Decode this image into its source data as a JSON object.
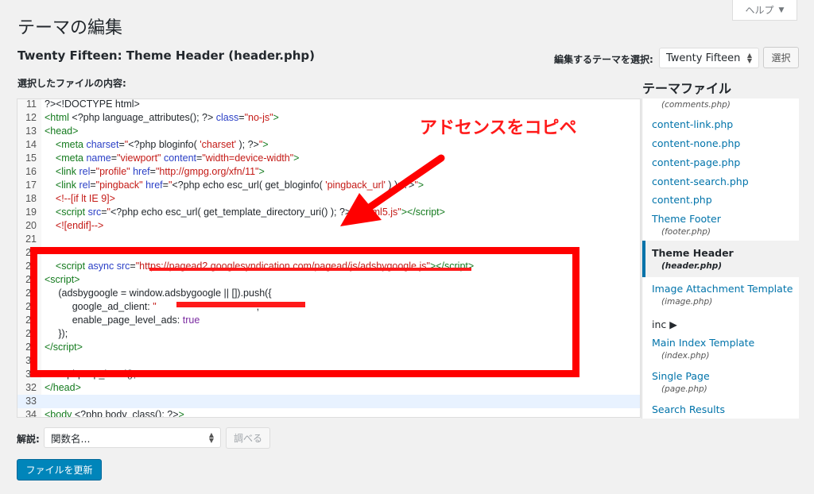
{
  "help": {
    "label": "ヘルプ",
    "arrow": "▼"
  },
  "page_title": "テーマの編集",
  "file_title": "Twenty Fifteen: Theme Header (header.php)",
  "theme_select": {
    "label": "編集するテーマを選択:",
    "value": "Twenty Fifteen",
    "button": "選択"
  },
  "content_label": "選択したファイルの内容:",
  "annotation": {
    "text": "アドセンスをコピペ",
    "color": "#ff0000"
  },
  "code_lines": [
    {
      "n": "11",
      "html": "?&gt;&lt;!DOCTYPE html&gt;"
    },
    {
      "n": "12",
      "html": "<span class=\"t\">&lt;html</span> &lt;?php language_attributes(); ?&gt; <span class=\"a\">class</span>=<span class=\"s\">\"no-js\"</span><span class=\"t\">&gt;</span>"
    },
    {
      "n": "13",
      "html": "<span class=\"t\">&lt;head&gt;</span>"
    },
    {
      "n": "14",
      "html": "    <span class=\"t\">&lt;meta</span> <span class=\"a\">charset</span>=<span class=\"s\">\"</span>&lt;?php bloginfo( <span class=\"s\">'charset'</span> ); ?&gt;<span class=\"s\">\"</span><span class=\"t\">&gt;</span>"
    },
    {
      "n": "15",
      "html": "    <span class=\"t\">&lt;meta</span> <span class=\"a\">name</span>=<span class=\"s\">\"viewport\"</span> <span class=\"a\">content</span>=<span class=\"s\">\"width=device-width\"</span><span class=\"t\">&gt;</span>"
    },
    {
      "n": "16",
      "html": "    <span class=\"t\">&lt;link</span> <span class=\"a\">rel</span>=<span class=\"s\">\"profile\"</span> <span class=\"a\">href</span>=<span class=\"s\">\"http://gmpg.org/xfn/11\"</span><span class=\"t\">&gt;</span>"
    },
    {
      "n": "17",
      "html": "    <span class=\"t\">&lt;link</span> <span class=\"a\">rel</span>=<span class=\"s\">\"pingback\"</span> <span class=\"a\">href</span>=<span class=\"s\">\"</span>&lt;?php echo esc_url( get_bloginfo( <span class=\"s\">'pingback_url'</span> ) ); ?&gt;<span class=\"s\">\"</span><span class=\"t\">&gt;</span>"
    },
    {
      "n": "18",
      "html": "    <span class=\"c\">&lt;!--[if lt IE 9]&gt;</span>"
    },
    {
      "n": "19",
      "html": "    <span class=\"t\">&lt;script</span> <span class=\"a\">src</span>=<span class=\"s\">\"</span>&lt;?php echo esc_url( get_template_directory_uri() ); ?&gt;<span class=\"s\">/js/html5.js\"</span><span class=\"t\">&gt;&lt;/script&gt;</span>"
    },
    {
      "n": "20",
      "html": "    <span class=\"c\">&lt;![endif]--&gt;</span>"
    },
    {
      "n": "21",
      "html": ""
    },
    {
      "n": "22",
      "html": ""
    },
    {
      "n": "23",
      "html": "    <span class=\"t\">&lt;script</span> <span class=\"a\">async</span> <span class=\"a\">src</span>=<span class=\"s\">\"https://pagead2.googlesyndication.com/pagead/js/adsbygoogle.js\"</span><span class=\"t\">&gt;&lt;/script&gt;</span>"
    },
    {
      "n": "24",
      "html": "<span class=\"t\">&lt;script&gt;</span>"
    },
    {
      "n": "25",
      "html": "     (adsbygoogle = window.adsbygoogle || []).push({"
    },
    {
      "n": "26",
      "html": "          google_ad_client: <span class=\"s\">\"                                   \"</span>,"
    },
    {
      "n": "27",
      "html": "          enable_page_level_ads: <span class=\"kw\">true</span>"
    },
    {
      "n": "28",
      "html": "     });"
    },
    {
      "n": "29",
      "html": "<span class=\"t\">&lt;/script&gt;</span>"
    },
    {
      "n": "30",
      "html": ""
    },
    {
      "n": "31",
      "html": "    &lt;?php wp_head(); ?&gt;"
    },
    {
      "n": "32",
      "html": "<span class=\"t\">&lt;/head&gt;</span>"
    },
    {
      "n": "33",
      "html": ""
    },
    {
      "n": "34",
      "html": "<span class=\"t\">&lt;body</span> &lt;?php body_class(); ?&gt;<span class=\"t\">&gt;</span>"
    }
  ],
  "file_list": {
    "title": "テーマファイル",
    "items": [
      {
        "label": "",
        "sub": "(comments.php)"
      },
      {
        "label": "content-link.php",
        "sub": ""
      },
      {
        "label": "content-none.php",
        "sub": ""
      },
      {
        "label": "content-page.php",
        "sub": ""
      },
      {
        "label": "content-search.php",
        "sub": ""
      },
      {
        "label": "content.php",
        "sub": ""
      },
      {
        "label": "Theme Footer",
        "sub": "(footer.php)"
      },
      {
        "label": "Theme Header",
        "sub": "(header.php)"
      },
      {
        "label": "Image Attachment Template",
        "sub": "(image.php)"
      },
      {
        "label": "inc ▶",
        "sub": ""
      },
      {
        "label": "Main Index Template",
        "sub": "(index.php)"
      },
      {
        "label": "Single Page",
        "sub": "(page.php)"
      },
      {
        "label": "Search Results",
        "sub": ""
      }
    ]
  },
  "documentation": {
    "label": "解説:",
    "placeholder": "関数名...",
    "lookup": "調べる"
  },
  "update_button": "ファイルを更新"
}
